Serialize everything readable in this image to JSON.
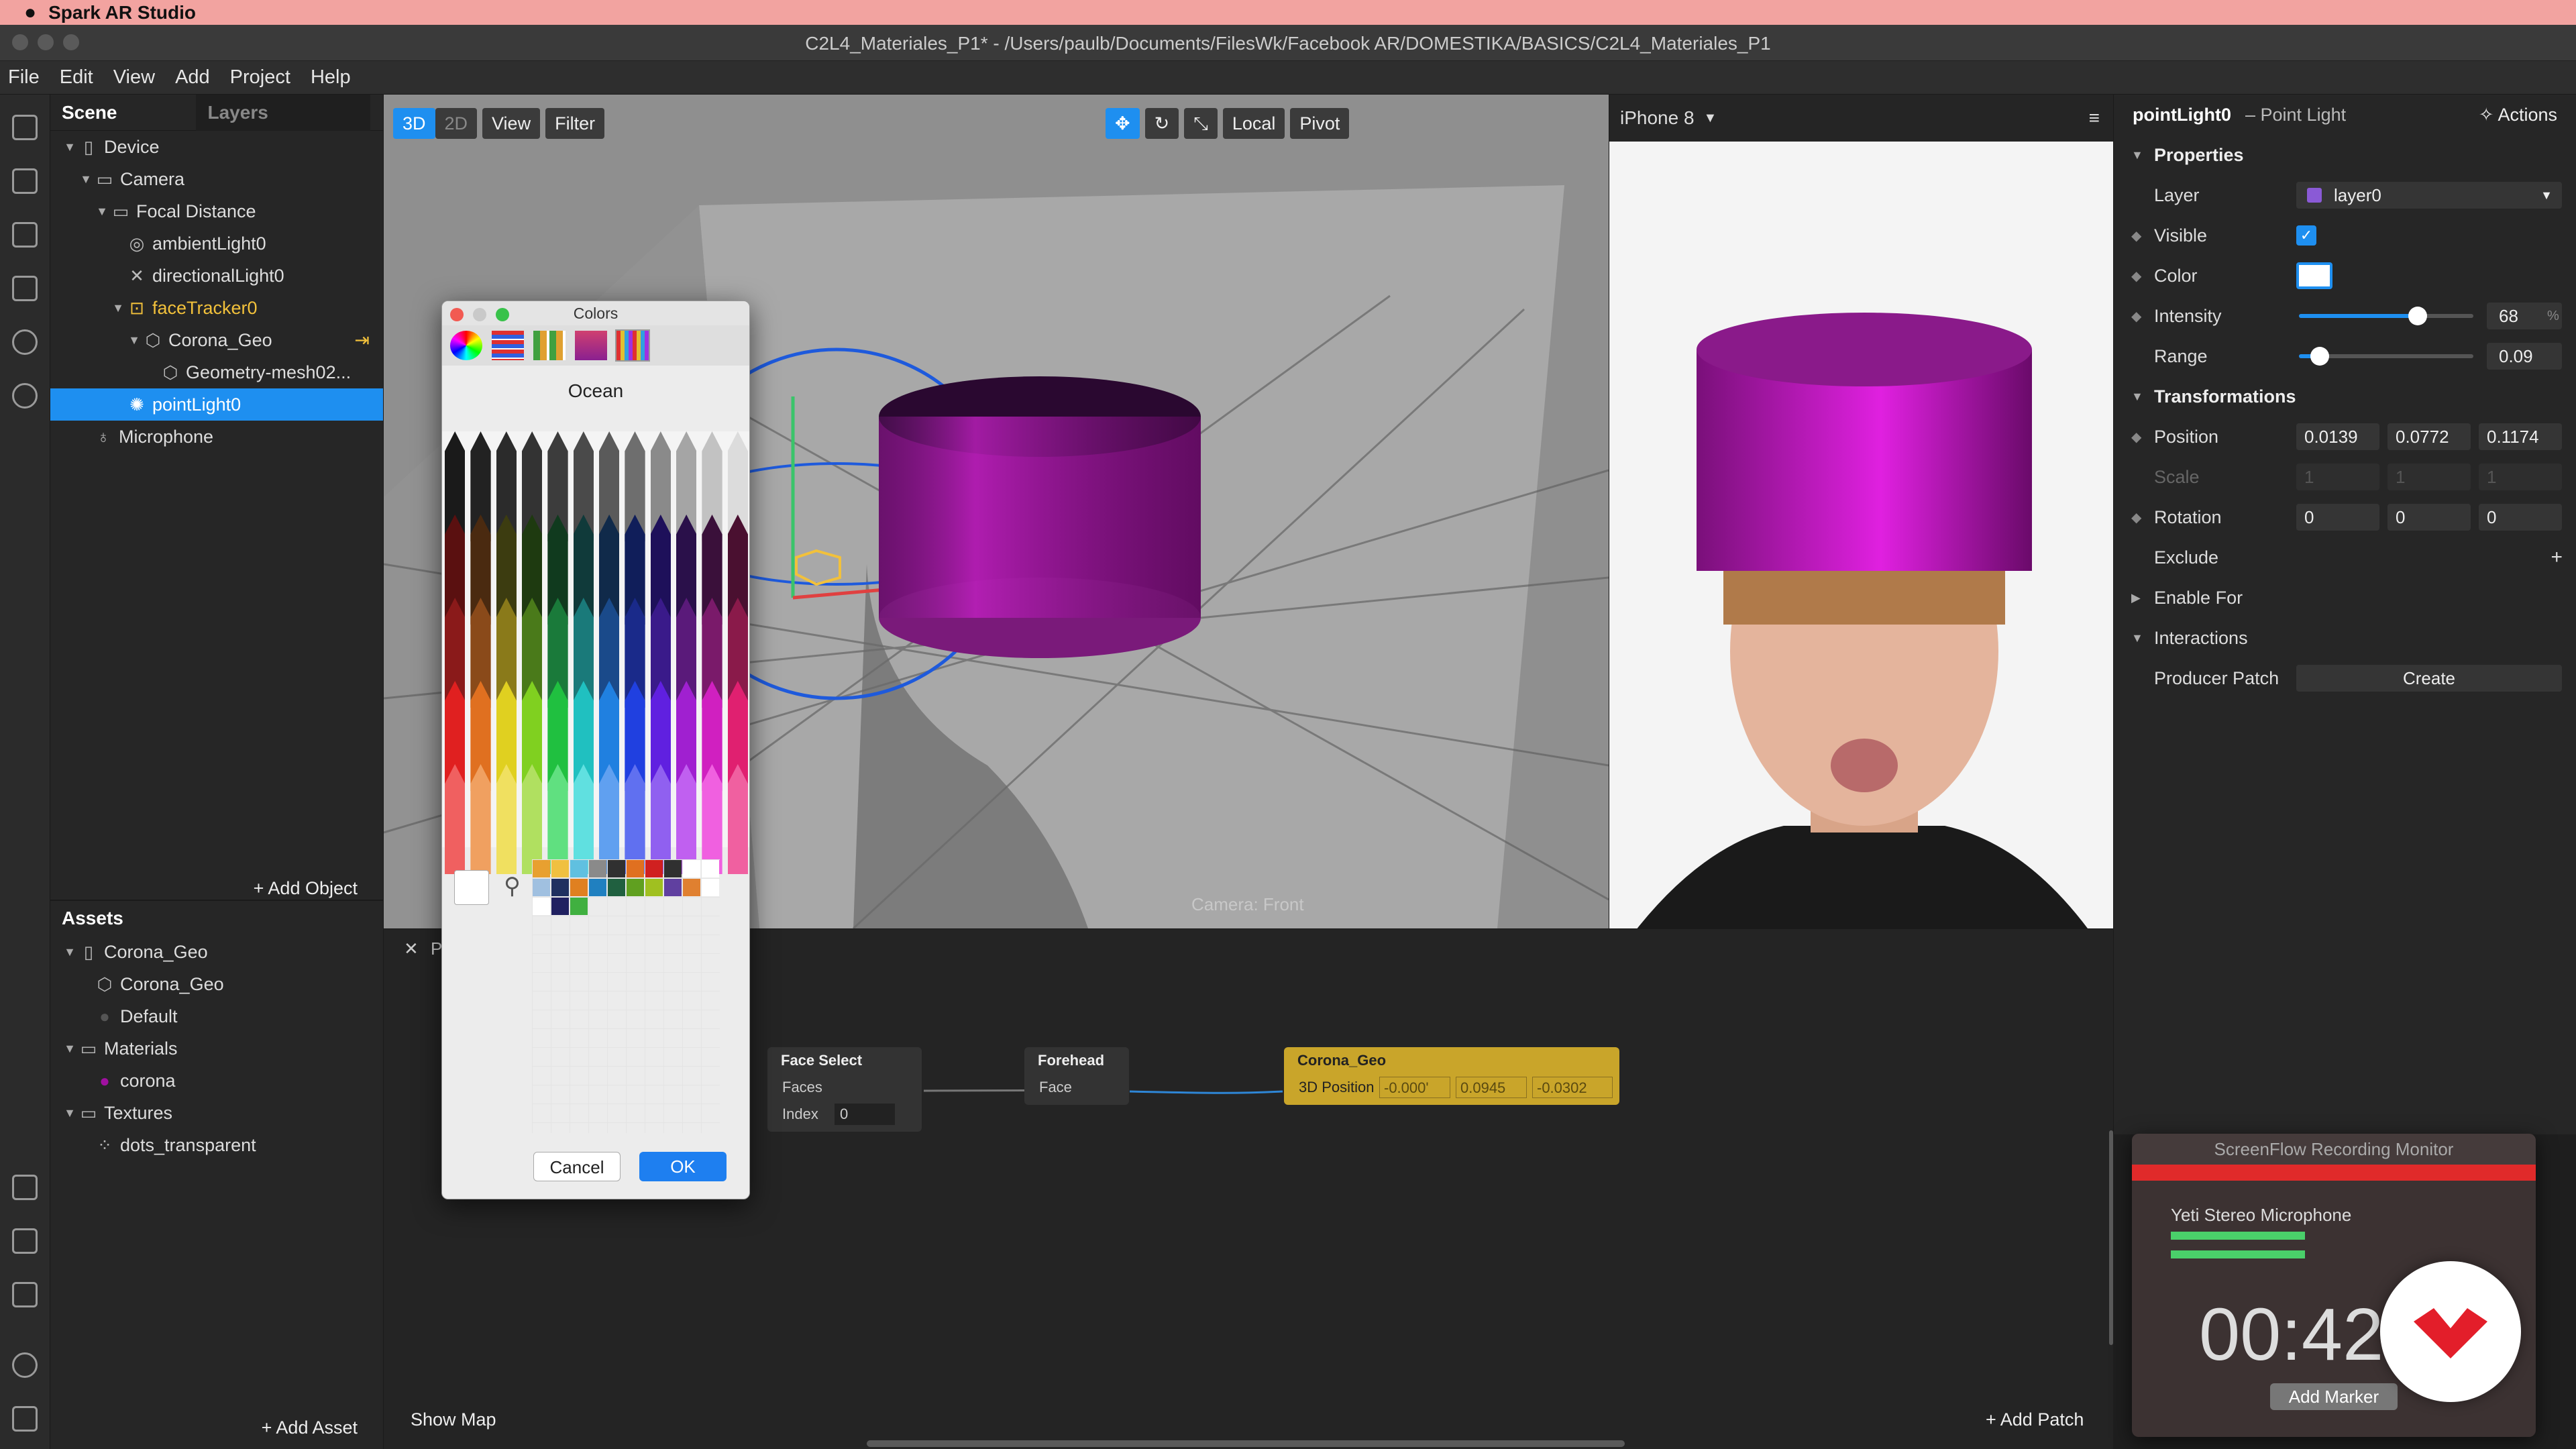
{
  "menubar": {
    "app": "Spark AR Studio"
  },
  "window": {
    "title": "C2L4_Materiales_P1* - /Users/paulb/Documents/FilesWk/Facebook AR/DOMESTIKA/BASICS/C2L4_Materiales_P1"
  },
  "menu": [
    "File",
    "Edit",
    "View",
    "Add",
    "Project",
    "Help"
  ],
  "scene": {
    "tab_scene": "Scene",
    "tab_layers": "Layers",
    "items": [
      {
        "label": "Device"
      },
      {
        "label": "Camera"
      },
      {
        "label": "Focal Distance"
      },
      {
        "label": "ambientLight0"
      },
      {
        "label": "directionalLight0"
      },
      {
        "label": "faceTracker0"
      },
      {
        "label": "Corona_Geo"
      },
      {
        "label": "Geometry-mesh02..."
      },
      {
        "label": "pointLight0"
      },
      {
        "label": "Microphone"
      }
    ],
    "add_object": "+ Add Object"
  },
  "assets": {
    "title": "Assets",
    "items": [
      {
        "label": "Corona_Geo"
      },
      {
        "label": "Corona_Geo"
      },
      {
        "label": "Default"
      },
      {
        "label": "Materials"
      },
      {
        "label": "corona"
      },
      {
        "label": "Textures"
      },
      {
        "label": "dots_transparent"
      }
    ],
    "add_asset": "+ Add Asset"
  },
  "viewport": {
    "btn_3d": "3D",
    "btn_2d": "2D",
    "view": "View",
    "filter": "Filter",
    "local": "Local",
    "pivot": "Pivot",
    "camera_label": "Camera: Front"
  },
  "phone": {
    "device": "iPhone 8"
  },
  "patch": {
    "show_map": "Show Map",
    "add_patch": "+ Add Patch",
    "tab_initial": "P",
    "face_select": {
      "title": "Face Select",
      "faces": "Faces",
      "index_label": "Index",
      "index_value": "0"
    },
    "forehead": {
      "title": "Forehead",
      "face": "Face"
    },
    "corona": {
      "title": "Corona_Geo",
      "port": "3D Position",
      "v1": "-0.000'",
      "v2": "0.0945",
      "v3": "-0.0302"
    }
  },
  "inspector": {
    "name": "pointLight0",
    "type": "– Point Light",
    "actions": "Actions",
    "properties": "Properties",
    "layer_label": "Layer",
    "layer_value": "layer0",
    "visible": "Visible",
    "color": "Color",
    "intensity": "Intensity",
    "intensity_value": "68",
    "intensity_unit": "%",
    "range": "Range",
    "range_value": "0.09",
    "intensity_fraction": 0.68,
    "range_fraction": 0.12,
    "transformations": "Transformations",
    "position": "Position",
    "pos_x": "0.0139",
    "pos_y": "0.0772",
    "pos_z": "0.1174",
    "scale": "Scale",
    "scale_x": "1",
    "scale_y": "1",
    "scale_z": "1",
    "rotation": "Rotation",
    "rot_x": "0",
    "rot_y": "0",
    "rot_z": "0",
    "exclude": "Exclude",
    "enable_for": "Enable For",
    "interactions": "Interactions",
    "producer_patch": "Producer Patch",
    "create": "Create"
  },
  "colors": {
    "title": "Colors",
    "palette": "Ocean",
    "cancel": "Cancel",
    "ok": "OK",
    "pencils": [
      "#1a1a1a",
      "#222",
      "#2b2b2b",
      "#333",
      "#3c3c3c",
      "#4a4a4a",
      "#5a5a5a",
      "#6e6e6e",
      "#8a8a8a",
      "#a5a5a5",
      "#c2c2c2",
      "#dcdcdc",
      "#5a1010",
      "#4a2a10",
      "#3c3c10",
      "#1e3a10",
      "#103a1e",
      "#103a3a",
      "#102a4a",
      "#101e5a",
      "#1e105a",
      "#2a104a",
      "#3a103a",
      "#4a1030",
      "#8a1a1a",
      "#8a4a1a",
      "#8a7a1a",
      "#4a7a1a",
      "#1a7a3a",
      "#1a7a7a",
      "#1a4a8a",
      "#1a2a8a",
      "#3a1a8a",
      "#5a1a7a",
      "#7a1a6a",
      "#8a1a4a",
      "#e02020",
      "#e07020",
      "#e0d020",
      "#80d020",
      "#20c040",
      "#20c0c0",
      "#2080e0",
      "#2040e0",
      "#6020e0",
      "#a020d0",
      "#d020c0",
      "#e02070",
      "#f06060",
      "#f0a060",
      "#f0e060",
      "#b0e060",
      "#60e080",
      "#60e0e0",
      "#60a0f0",
      "#6070f0",
      "#9060f0",
      "#c060f0",
      "#f060e0",
      "#f060a0"
    ],
    "swatches": [
      "#e8a030",
      "#f0c040",
      "#60c0e0",
      "#8a8a8a",
      "#303030",
      "#e07020",
      "#d02020",
      "#303030",
      "#ffffff",
      "#ffffff",
      "#a0c0e0",
      "#203060",
      "#e08020",
      "#2080c0",
      "#206040",
      "#60a020",
      "#a0c020",
      "#6040a0",
      "#e08030",
      "#ffffff",
      "#ffffff",
      "#202060",
      "#40b040"
    ]
  },
  "sfmon": {
    "title": "ScreenFlow Recording Monitor",
    "mic": "Yeti Stereo Microphone",
    "time": "00:42:",
    "marker": "Add Marker"
  }
}
